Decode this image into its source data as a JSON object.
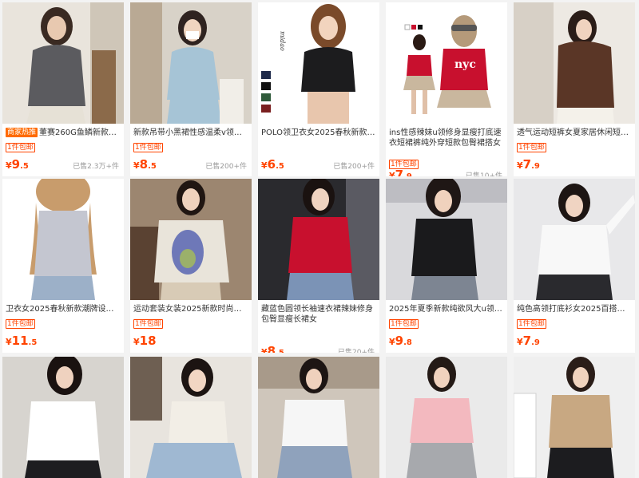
{
  "colors": {
    "accent": "#ff4400",
    "brand_tag_bg": "#ff6a00"
  },
  "products": [
    {
      "title": "董赛260G鱼鳞新款宽松...",
      "brand_tag": "商家热推",
      "promo": "1件包邮",
      "price_int": "9",
      "price_dec": ".5",
      "sold": "已售2.3万+件"
    },
    {
      "title": "新款吊带小黑裙性感温柔v领打...",
      "brand_tag": "",
      "promo": "1件包邮",
      "price_int": "8",
      "price_dec": ".5",
      "sold": "已售200+件"
    },
    {
      "title": "POLO领卫衣女2025春秋新款拼...",
      "brand_tag": "",
      "promo": "",
      "price_int": "6",
      "price_dec": ".5",
      "sold": "已售200+件"
    },
    {
      "title": "ins性感辣妹u领修身显瘦打底速衣短裙裤纯外穿短款包臀裙搭女装搭",
      "brand_tag": "",
      "promo": "1件包邮",
      "price_int": "7",
      "price_dec": ".9",
      "sold": "已售10+件"
    },
    {
      "title": "透气运动短裤女夏家居休闲短裤...",
      "brand_tag": "",
      "promo": "1件包邮",
      "price_int": "7",
      "price_dec": ".9",
      "sold": ""
    },
    {
      "title": "卫衣女2025春秋新款潮牌设计...",
      "brand_tag": "",
      "promo": "1件包邮",
      "price_int": "11",
      "price_dec": ".5",
      "sold": ""
    },
    {
      "title": "运动套装女装2025新款时尚套...",
      "brand_tag": "",
      "promo": "1件包邮",
      "price_int": "18",
      "price_dec": "",
      "sold": ""
    },
    {
      "title": "藏蓝色圆领长袖速衣裙辣妹修身包臀显瘦长裙女",
      "brand_tag": "",
      "promo": "",
      "price_int": "8",
      "price_dec": ".5",
      "sold": "已售20+件"
    },
    {
      "title": "2025年夏季新款纯欲风大u领辣...",
      "brand_tag": "",
      "promo": "1件包邮",
      "price_int": "9",
      "price_dec": ".8",
      "sold": ""
    },
    {
      "title": "纯色高领打底衫女2025百搭韩...",
      "brand_tag": "",
      "promo": "1件包邮",
      "price_int": "7",
      "price_dec": ".9",
      "sold": ""
    },
    {
      "title": "",
      "brand_tag": "",
      "promo": "",
      "price_int": "",
      "price_dec": "",
      "sold": ""
    },
    {
      "title": "",
      "brand_tag": "",
      "promo": "",
      "price_int": "",
      "price_dec": "",
      "sold": ""
    },
    {
      "title": "",
      "brand_tag": "",
      "promo": "",
      "price_int": "",
      "price_dec": "",
      "sold": ""
    },
    {
      "title": "",
      "brand_tag": "",
      "promo": "",
      "price_int": "",
      "price_dec": "",
      "sold": ""
    },
    {
      "title": "",
      "brand_tag": "",
      "promo": "",
      "price_int": "",
      "price_dec": "",
      "sold": ""
    }
  ],
  "product_image_watermarks": [
    "midao",
    "nyc"
  ],
  "currency_symbol": "¥"
}
